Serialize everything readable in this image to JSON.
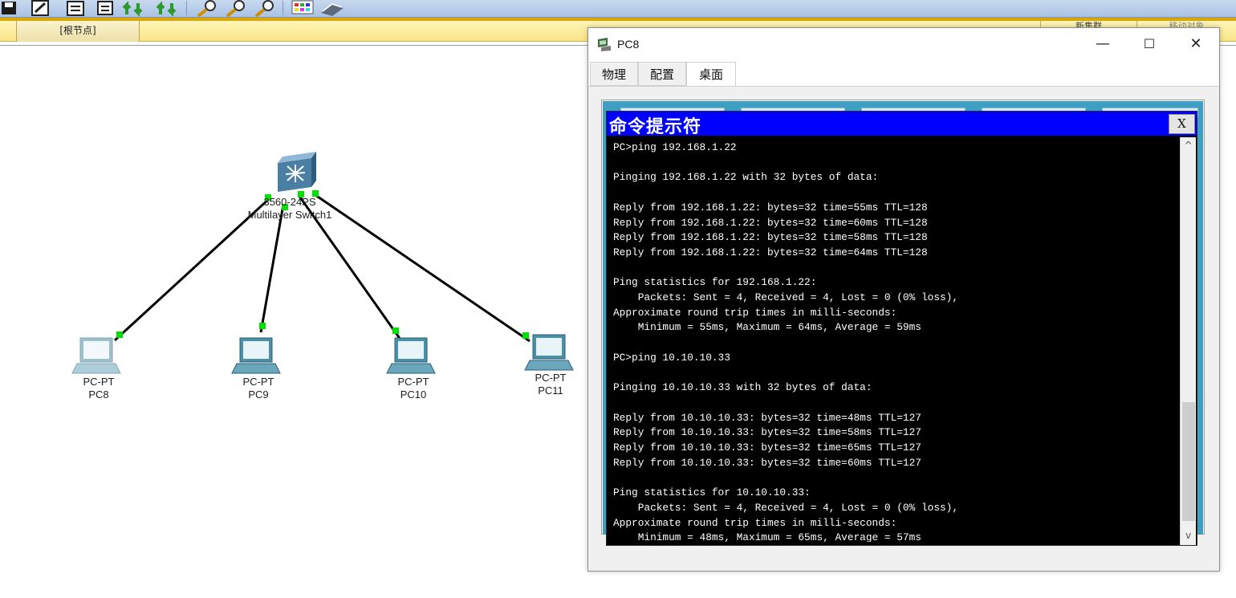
{
  "toolbar": {
    "icons": [
      "save-icon",
      "edit-icon",
      "copy-icon",
      "paste-icon",
      "arrow-up-icon",
      "arrow-down-icon",
      "zoom-in-icon",
      "zoom-reset-icon",
      "zoom-out-icon",
      "palette-icon",
      "book-icon"
    ]
  },
  "nav": {
    "root_node": "[根节点]",
    "right_tab_1": "新集群",
    "right_tab_2": "移动对象"
  },
  "topology": {
    "switch": {
      "model": "3560-24PS",
      "name": "Multilayer Switch1"
    },
    "pcs": [
      {
        "type": "PC-PT",
        "name": "PC8"
      },
      {
        "type": "PC-PT",
        "name": "PC9"
      },
      {
        "type": "PC-PT",
        "name": "PC10"
      },
      {
        "type": "PC-PT",
        "name": "PC11"
      }
    ],
    "link_status_color": "#00e000"
  },
  "window": {
    "title": "PC8",
    "minimize": "—",
    "maximize": "☐",
    "close": "✕",
    "tabs": [
      {
        "label": "物理"
      },
      {
        "label": "配置"
      },
      {
        "label": "桌面"
      }
    ],
    "active_tab": "桌面"
  },
  "cmd": {
    "title": "命令提示符",
    "close_label": "X",
    "lines": [
      "PC>ping 192.168.1.22",
      "",
      "Pinging 192.168.1.22 with 32 bytes of data:",
      "",
      "Reply from 192.168.1.22: bytes=32 time=55ms TTL=128",
      "Reply from 192.168.1.22: bytes=32 time=60ms TTL=128",
      "Reply from 192.168.1.22: bytes=32 time=58ms TTL=128",
      "Reply from 192.168.1.22: bytes=32 time=64ms TTL=128",
      "",
      "Ping statistics for 192.168.1.22:",
      "    Packets: Sent = 4, Received = 4, Lost = 0 (0% loss),",
      "Approximate round trip times in milli-seconds:",
      "    Minimum = 55ms, Maximum = 64ms, Average = 59ms",
      "",
      "PC>ping 10.10.10.33",
      "",
      "Pinging 10.10.10.33 with 32 bytes of data:",
      "",
      "Reply from 10.10.10.33: bytes=32 time=48ms TTL=127",
      "Reply from 10.10.10.33: bytes=32 time=58ms TTL=127",
      "Reply from 10.10.10.33: bytes=32 time=65ms TTL=127",
      "Reply from 10.10.10.33: bytes=32 time=60ms TTL=127",
      "",
      "Ping statistics for 10.10.10.33:",
      "    Packets: Sent = 4, Received = 4, Lost = 0 (0% loss),",
      "Approximate round trip times in milli-seconds:",
      "    Minimum = 48ms, Maximum = 65ms, Average = 57ms"
    ],
    "scroll_up": "^",
    "scroll_down": "v"
  },
  "colors": {
    "cmd_title_bg": "#0000ff",
    "desktop_bg": "#3e9fc3",
    "toolbar_bg": "#b7cce8",
    "nav_bg": "#f9e586"
  }
}
